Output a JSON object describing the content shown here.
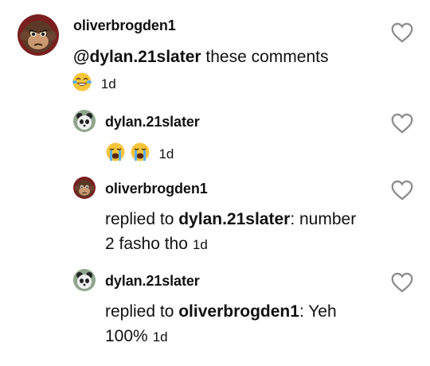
{
  "comments": [
    {
      "username": "oliverbrogden1",
      "mention": "@dylan.21slater",
      "text": "these comments",
      "emoji": "laughing-tears",
      "time": "1d"
    },
    {
      "username": "dylan.21slater",
      "emoji": "crying-face",
      "time": "1d"
    },
    {
      "username": "oliverbrogden1",
      "prefix": "replied to",
      "mention": "dylan.21slater",
      "text_line1": ": number",
      "text_line2": "2 fasho tho",
      "time": "1d"
    },
    {
      "username": "dylan.21slater",
      "prefix": "replied to",
      "mention": "oliverbrogden1",
      "text_line1": ": Yeh",
      "text_line2": "100%",
      "time": "1d"
    }
  ],
  "colors": {
    "text": "#111111",
    "heart_outline": "#8e8e8e",
    "background": "#ffffff"
  }
}
